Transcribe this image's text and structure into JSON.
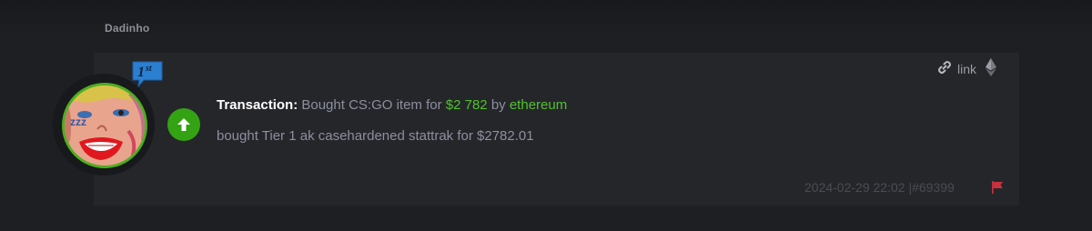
{
  "post": {
    "username": "Dadinho",
    "rank_badge": "1st",
    "transaction_label": "Transaction:",
    "description_prefix": "Bought CS:GO item for",
    "amount": "$2 782",
    "by_word": "by",
    "currency": "ethereum",
    "details": "bought Tier 1 ak casehardened stattrak for $2782.01",
    "link_label": "link",
    "timestamp": "2024-02-29 22:02",
    "separator": "|",
    "post_id": "#69399"
  },
  "colors": {
    "accent_green": "#4fc32a",
    "badge_blue": "#2b7fd0",
    "flag_red": "#c8323c",
    "up_button": "#34a313"
  },
  "icons": {
    "up": "arrow-up-icon",
    "link": "chain-link-icon",
    "crypto": "ethereum-icon",
    "report": "flag-icon"
  }
}
